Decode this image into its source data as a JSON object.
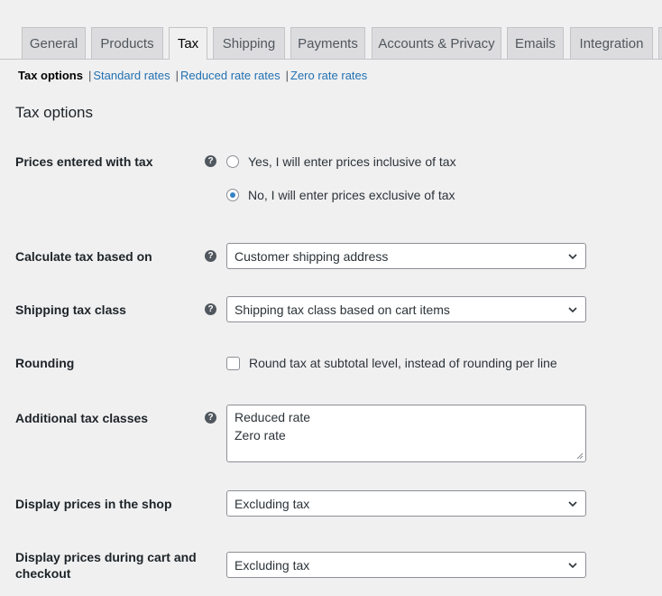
{
  "tabs": [
    {
      "label": "General"
    },
    {
      "label": "Products"
    },
    {
      "label": "Tax",
      "active": true
    },
    {
      "label": "Shipping"
    },
    {
      "label": "Payments"
    },
    {
      "label": "Accounts & Privacy"
    },
    {
      "label": "Emails"
    },
    {
      "label": "Integration"
    }
  ],
  "sections": {
    "current": "Tax options",
    "links": [
      "Standard rates",
      "Reduced rate rates",
      "Zero rate rates"
    ],
    "separator": "|"
  },
  "page_title": "Tax options",
  "help_glyph": "?",
  "fields": {
    "prices_entered": {
      "label": "Prices entered with tax",
      "options": [
        {
          "label": "Yes, I will enter prices inclusive of tax",
          "checked": false
        },
        {
          "label": "No, I will enter prices exclusive of tax",
          "checked": true
        }
      ]
    },
    "calculate_based_on": {
      "label": "Calculate tax based on",
      "value": "Customer shipping address"
    },
    "shipping_tax_class": {
      "label": "Shipping tax class",
      "value": "Shipping tax class based on cart items"
    },
    "rounding": {
      "label": "Rounding",
      "checkbox_label": "Round tax at subtotal level, instead of rounding per line",
      "checked": false
    },
    "additional_classes": {
      "label": "Additional tax classes",
      "lines": [
        "Reduced rate",
        "Zero rate"
      ]
    },
    "display_shop": {
      "label": "Display prices in the shop",
      "value": "Excluding tax"
    },
    "display_cart": {
      "label_line1": "Display prices during cart and",
      "label_line2": "checkout",
      "value": "Excluding tax"
    }
  },
  "colors": {
    "accent": "#2271b1",
    "radio_checked": "#3582c4",
    "background": "#f0f0f1"
  }
}
